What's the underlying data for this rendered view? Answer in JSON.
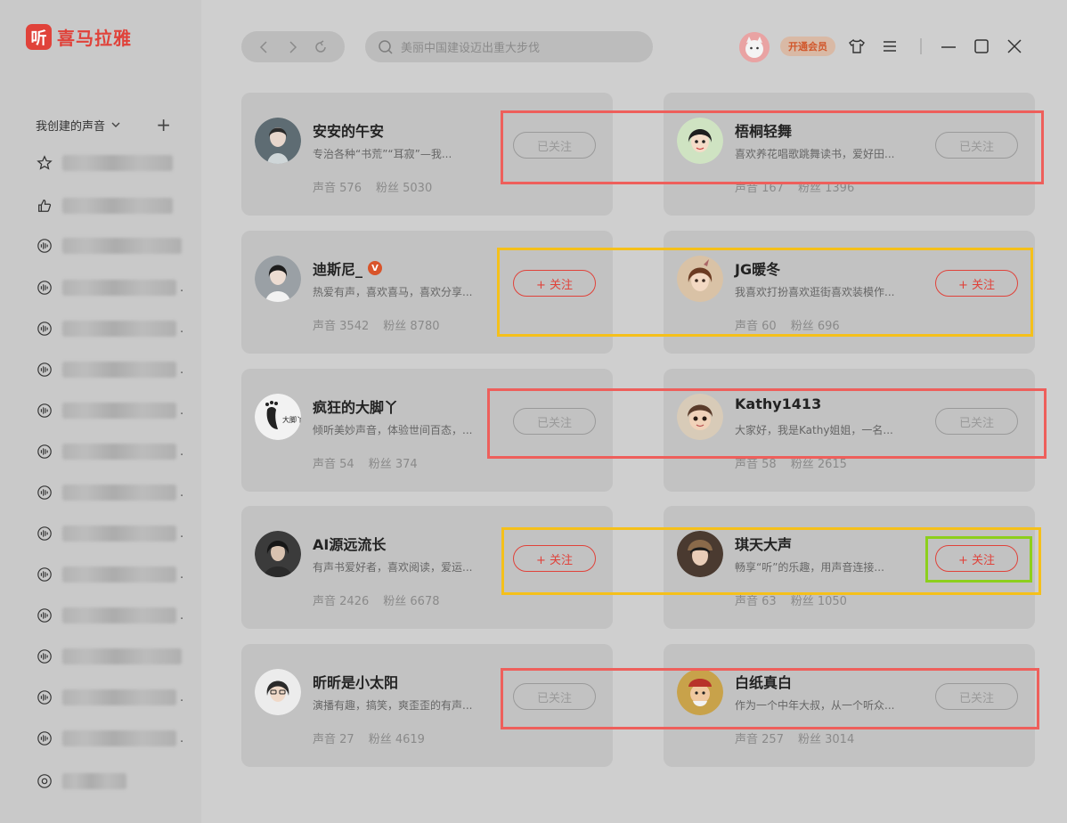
{
  "brand": {
    "badge": "听",
    "name": "喜马拉雅"
  },
  "sidebar": {
    "section_label": "我创建的声音",
    "add_symbol": "+",
    "ellipsis": "."
  },
  "search": {
    "placeholder": "美丽中国建设迈出重大步伐"
  },
  "header": {
    "vip_label": "开通会员"
  },
  "labels": {
    "followed": "已关注",
    "follow": "+ 关注",
    "voice": "声音",
    "fans": "粉丝"
  },
  "cards": [
    {
      "name": "安安的午安",
      "desc": "专治各种“书荒”“耳寂”—我...",
      "voice": "576",
      "fans": "5030",
      "followed": true
    },
    {
      "name": "梧桐轻舞",
      "desc": "喜欢养花唱歌跳舞读书，爱好田...",
      "voice": "167",
      "fans": "1396",
      "followed": true
    },
    {
      "name": "迪斯尼_",
      "desc": "热爱有声，喜欢喜马，喜欢分享...",
      "voice": "3542",
      "fans": "8780",
      "followed": false
    },
    {
      "name": "JG暖冬",
      "desc": "我喜欢打扮喜欢逛街喜欢装模作...",
      "voice": "60",
      "fans": "696",
      "followed": false
    },
    {
      "name": "疯狂的大脚丫",
      "desc": "倾听美妙声音，体验世间百态，...",
      "voice": "54",
      "fans": "374",
      "followed": true
    },
    {
      "name": "Kathy1413",
      "desc": "大家好，我是Kathy姐姐，一名...",
      "voice": "58",
      "fans": "2615",
      "followed": true
    },
    {
      "name": "AI源远流长",
      "desc": "有声书爱好者，喜欢阅读，爱运...",
      "voice": "2426",
      "fans": "6678",
      "followed": false
    },
    {
      "name": "琪天大声",
      "desc": "畅享“听”的乐趣，用声音连接...",
      "voice": "63",
      "fans": "1050",
      "followed": false
    },
    {
      "name": "昕昕是小太阳",
      "desc": "演播有趣，搞笑，爽歪歪的有声...",
      "voice": "27",
      "fans": "4619",
      "followed": true
    },
    {
      "name": "白纸真白",
      "desc": "作为一个中年大叔，从一个听众...",
      "voice": "257",
      "fans": "3014",
      "followed": true
    }
  ],
  "colors": {
    "brand": "#e0423a",
    "highlight_red": "#ee5f5b",
    "highlight_yellow": "#f5c01a",
    "highlight_green": "#8ccf1c"
  }
}
